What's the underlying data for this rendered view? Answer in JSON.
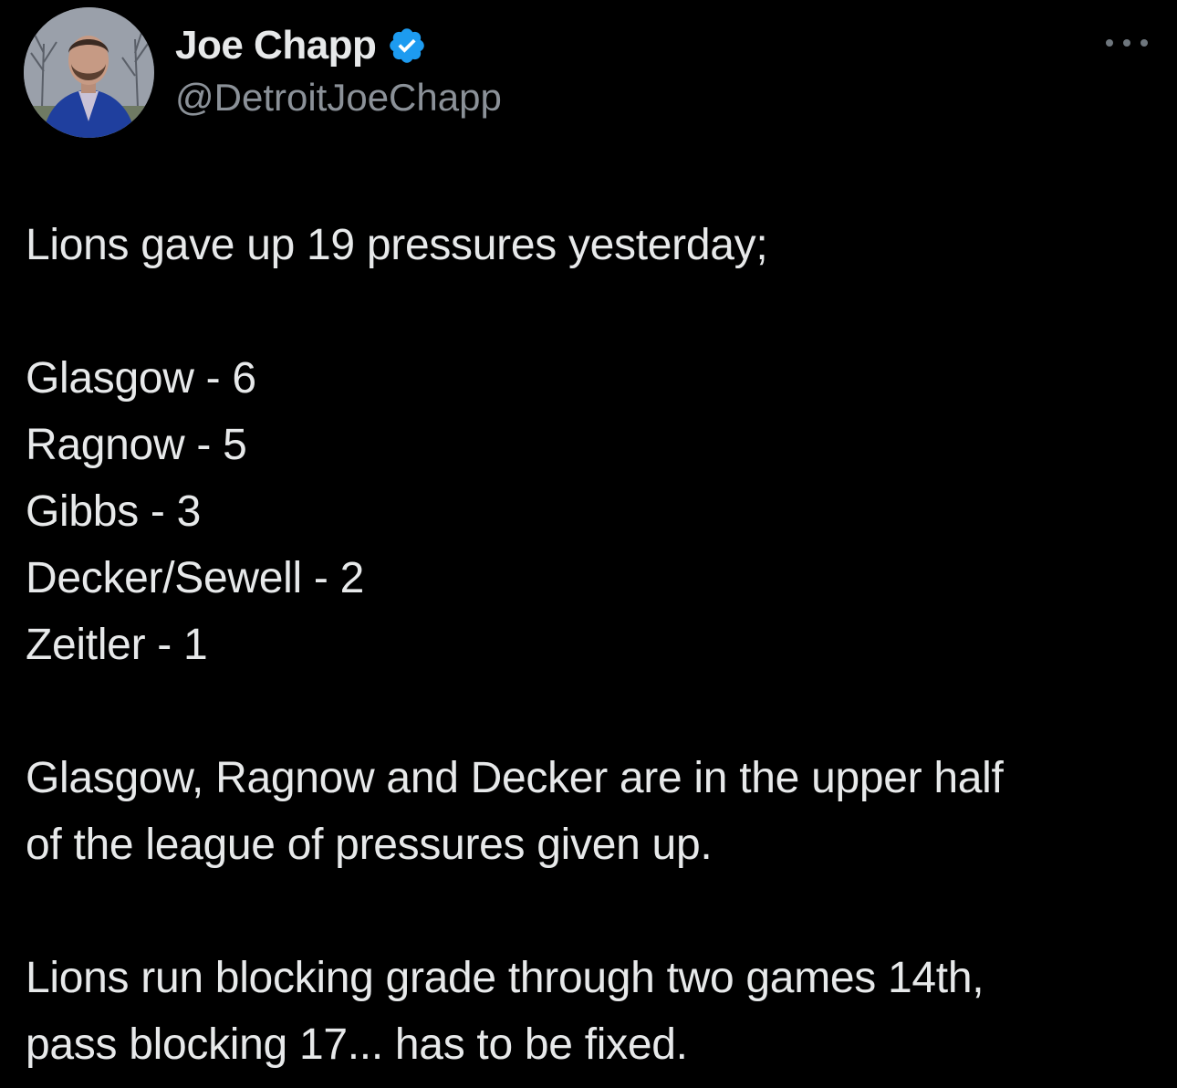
{
  "tweet": {
    "author": {
      "display_name": "Joe Chapp",
      "handle": "@DetroitJoeChapp",
      "verified": true,
      "verified_color": "#1d9bf0"
    },
    "more_icon": "more-horizontal-icon",
    "text_lines": [
      "Lions gave up 19 pressures yesterday;",
      "",
      "Glasgow - 6",
      "Ragnow - 5",
      "Gibbs - 3",
      "Decker/Sewell - 2",
      "Zeitler - 1",
      "",
      "Glasgow, Ragnow and Decker are in the upper half",
      "of the league of pressures given up.",
      "",
      "Lions run blocking grade through two games 14th,",
      "pass blocking 17... has to be fixed."
    ]
  },
  "colors": {
    "background": "#000000",
    "text_primary": "#e7e9ea",
    "text_secondary": "#8b9198"
  }
}
